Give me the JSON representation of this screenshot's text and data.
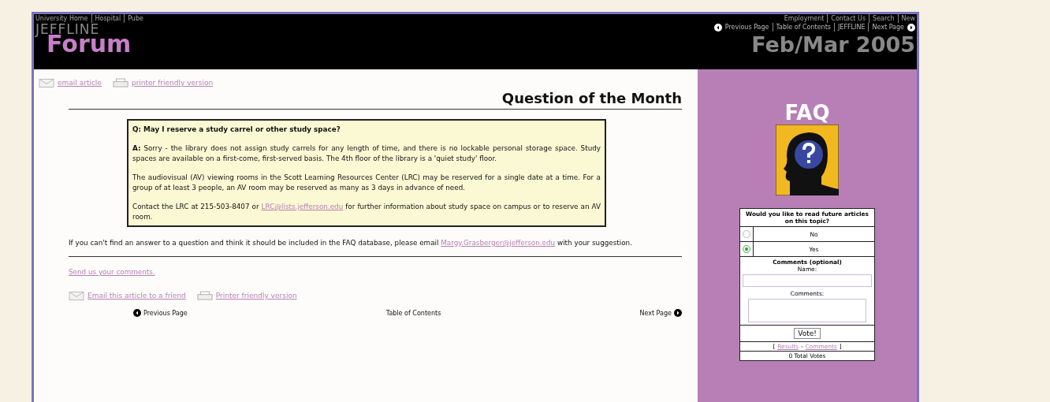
{
  "header": {
    "top_links": [
      "University Home",
      "Hospital",
      "Pube"
    ],
    "right_links": [
      "Employment",
      "Contact Us",
      "Search",
      "New"
    ],
    "nav_links": [
      "Previous Page",
      "Table of Contents",
      "JEFFLINE",
      "Next Page"
    ],
    "logo_top": "JEFFLINE",
    "logo": "Forum",
    "issue": "Feb/Mar 2005"
  },
  "article": {
    "tools": [
      "email article",
      "printer friendly version"
    ],
    "title": "Question of the Month",
    "question": "Q: May I reserve a study carrel or other study space?",
    "answer": [
      "**A:** Sorry - the library does not assign study carrels for any length of time, and there is no lockable personal storage space. Study spaces are available on a first-come, first-served basis. The 4th floor of the library is a 'quiet study' floor.",
      "The audiovisual (AV) viewing rooms in the Scott Learning Resources Center (LRC) may be reserved for a single date at a time. For a group of at least 3 people, an AV room may be reserved as many as 3 days in advance of need."
    ],
    "contact": {
      "before": "Contact the LRC at 215-503-8407 or",
      "link": "LRC@lists.jefferson.edu",
      "after": "for further information about study space on campus or to reserve an AV room."
    },
    "footer_note": {
      "before": "If you can't find an answer to a question and think it should be included in the FAQ database, please email",
      "link": "Margy.Grasberger@jefferson.edu",
      "after": "with your suggestion."
    },
    "send_comments": "Send us your comments.",
    "bottom_tools": [
      "Email this article to a friend",
      "Printer friendly version"
    ],
    "bottom_nav": [
      "Previous Page",
      "Table of Contents",
      "Next Page"
    ]
  },
  "sidebar": {
    "title": "FAQ",
    "poll": {
      "question": "Would you like to read future articles on this topic?",
      "options": [
        {
          "label": "No",
          "selected": false
        },
        {
          "label": "Yes",
          "selected": true
        }
      ],
      "comments_heading": "Comments (optional)",
      "name_label": "Name:",
      "comments_label": "Comments:",
      "button": "Vote!",
      "link_open": "[",
      "links": [
        "Results",
        "Comments"
      ],
      "link_separator": "-",
      "link_close": "]",
      "total": "0 Total Votes"
    }
  }
}
